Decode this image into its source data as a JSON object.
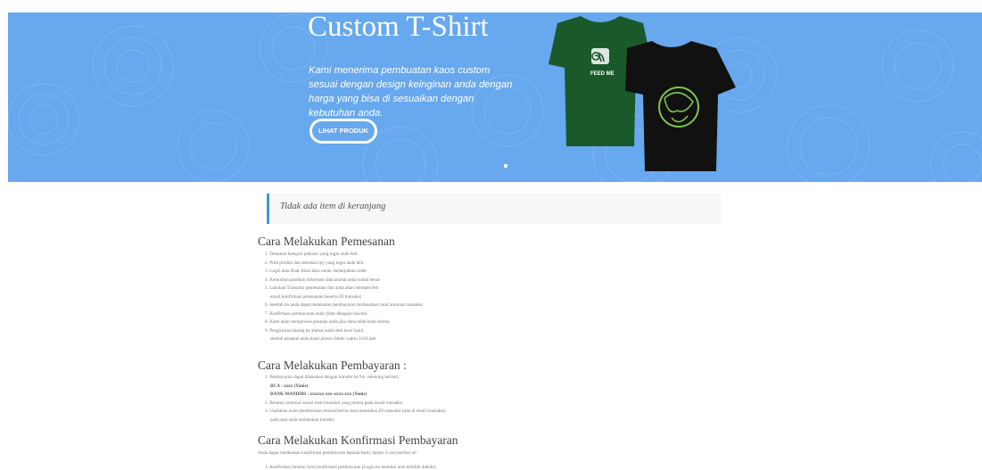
{
  "hero": {
    "title": "Custom T-Shirt",
    "description": "Kami menerima pembuatan kaos custom sesuai dengan design keinginan anda dengan harga yang bisa di sesuaikan dengan kebutuhan anda.",
    "button_label": "LIHAT PRODUK",
    "shirt_text": "FEED ME",
    "colors": {
      "background": "#67a8ee",
      "shirt_green": "#1a5a2a",
      "shirt_black": "#111111"
    }
  },
  "cart": {
    "empty_message": "Tidak ada item di keranjang"
  },
  "ordering": {
    "title": "Cara Melakukan Pemesanan",
    "steps": [
      "1. Tentukan kategori pakaian yang ingin anda beli.",
      "2. Pilih produk dan tentukan qty yang ingin anda beli.",
      "3. Login atau Buat Akun baru untuk melanjutkan order",
      "4. Kemudian pastikan informasi data alamat anda sudah benar",
      "5. Lakukan Transaksi pemesanan dan anda akan memperoleh",
      "   email konfirmasi pemesanan beserta ID transaksi",
      "6. Setelah itu anda dapat melakukan pembayaran berdasarkan total nominal transaksi.",
      "7. Konfirmasi pembayaran anda (lihat dibagian bawah)",
      "8. Kami akan memproses pesanan anda jika dana telah kami terima",
      "9. Pengiriman barang ke alamat anda oleh kurir kami,",
      "   setelah pesanan anda kami proses dalam waktu 2x24 jam."
    ]
  },
  "payment": {
    "title": "Cara Melakukan Pembayaran :",
    "step1": "1. Pembayaran dapat dilakukan dengan transfer ke No. rekening berikut :",
    "bca": "BCA : xxxx (Yanis)",
    "mandiri": "BANK MANDIRI : xxxxxx-xxx-xxxx-xxx (Yanis)",
    "step2": "2. Besaran nominal sesuai total transaksi yang tertera pada email transaksi.",
    "step3": "3. Usahakan anda memberikan remark/berita mencantumkan ID transaksi (ada di email transaksi)",
    "step3b": "   pada saat anda melakukan transfer."
  },
  "confirmation": {
    "title": "Cara Melakukan Konfirmasi Pembayaran",
    "intro": "Anda dapat melakukan konfirmasi pembayaran kepada kami, dalam 3 cara berikut ini :",
    "step1": "1. Konfirmasi melalui form konfirmasi pembayaran (Login ke member area terlebih dahulu)"
  }
}
